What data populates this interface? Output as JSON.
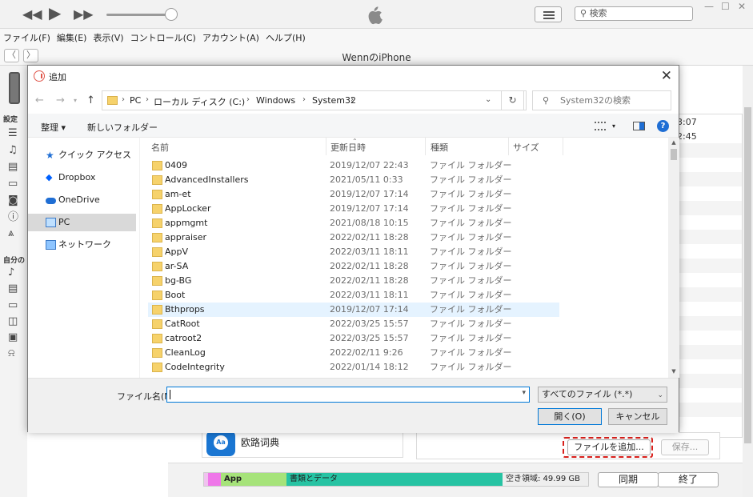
{
  "itunes": {
    "menu": [
      "ファイル(F)",
      "編集(E)",
      "表示(V)",
      "コントロール(C)",
      "アカウント(A)",
      "ヘルプ(H)"
    ],
    "search_placeholder": "検索",
    "device_title": "WennのiPhone",
    "sidebar_settings": "設定",
    "sidebar_mine": "自分の",
    "times": [
      "3:07",
      "2:45"
    ],
    "app_name": "欧路词典",
    "add_file_label": "ファイルを追加...",
    "save_label": "保存...",
    "storage": {
      "app_label": "App",
      "books_label": "書類とデータ",
      "free_label": "空き領域: 49.99 GB"
    },
    "sync_label": "同期",
    "done_label": "終了",
    "highlight_color": "#d8201b"
  },
  "dialog": {
    "title": "追加",
    "breadcrumb": [
      "PC",
      "ローカル ディスク (C:)",
      "Windows",
      "System32"
    ],
    "search_placeholder": "System32の検索",
    "organize_label": "整理 ▾",
    "new_folder_label": "新しいフォルダー",
    "nav": [
      "クイック アクセス",
      "Dropbox",
      "OneDrive",
      "PC",
      "ネットワーク"
    ],
    "columns": [
      "名前",
      "更新日時",
      "種類",
      "サイズ"
    ],
    "files": [
      {
        "name": "0409",
        "date": "2019/12/07 22:43",
        "type": "ファイル フォルダー"
      },
      {
        "name": "AdvancedInstallers",
        "date": "2021/05/11 0:33",
        "type": "ファイル フォルダー"
      },
      {
        "name": "am-et",
        "date": "2019/12/07 17:14",
        "type": "ファイル フォルダー"
      },
      {
        "name": "AppLocker",
        "date": "2019/12/07 17:14",
        "type": "ファイル フォルダー"
      },
      {
        "name": "appmgmt",
        "date": "2021/08/18 10:15",
        "type": "ファイル フォルダー"
      },
      {
        "name": "appraiser",
        "date": "2022/02/11 18:28",
        "type": "ファイル フォルダー"
      },
      {
        "name": "AppV",
        "date": "2022/03/11 18:11",
        "type": "ファイル フォルダー"
      },
      {
        "name": "ar-SA",
        "date": "2022/02/11 18:28",
        "type": "ファイル フォルダー"
      },
      {
        "name": "bg-BG",
        "date": "2022/02/11 18:28",
        "type": "ファイル フォルダー"
      },
      {
        "name": "Boot",
        "date": "2022/03/11 18:11",
        "type": "ファイル フォルダー"
      },
      {
        "name": "Bthprops",
        "date": "2019/12/07 17:14",
        "type": "ファイル フォルダー"
      },
      {
        "name": "CatRoot",
        "date": "2022/03/25 15:57",
        "type": "ファイル フォルダー"
      },
      {
        "name": "catroot2",
        "date": "2022/03/25 15:57",
        "type": "ファイル フォルダー"
      },
      {
        "name": "CleanLog",
        "date": "2022/02/11 9:26",
        "type": "ファイル フォルダー"
      },
      {
        "name": "CodeIntegrity",
        "date": "2022/01/14 18:12",
        "type": "ファイル フォルダー"
      }
    ],
    "filename_label": "ファイル名(N):",
    "filename_value": "",
    "filetype_value": "すべてのファイル (*.*)",
    "open_label": "開く(O)",
    "cancel_label": "キャンセル",
    "accent_color": "#0078d7"
  }
}
